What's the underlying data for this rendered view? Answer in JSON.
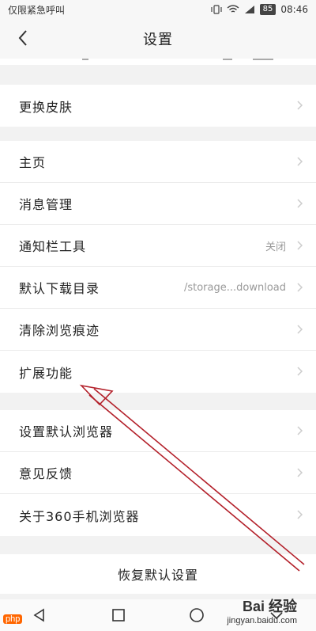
{
  "statusbar": {
    "left_text": "仅限紧急呼叫",
    "battery": "85",
    "time": "08:46"
  },
  "navbar": {
    "title": "设置"
  },
  "groups": {
    "g1": {
      "items": [
        {
          "label": "更换皮肤"
        }
      ]
    },
    "g2": {
      "items": [
        {
          "label": "主页"
        },
        {
          "label": "消息管理"
        },
        {
          "label": "通知栏工具",
          "value": "关闭"
        },
        {
          "label": "默认下载目录",
          "value": "/storage...download"
        },
        {
          "label": "清除浏览痕迹"
        },
        {
          "label": "扩展功能"
        }
      ]
    },
    "g3": {
      "items": [
        {
          "label": "设置默认浏览器"
        },
        {
          "label": "意见反馈"
        },
        {
          "label": "关于360手机浏览器"
        }
      ]
    }
  },
  "restore_label": "恢复默认设置",
  "watermark": {
    "php": "php",
    "baidu": "Bai 经验",
    "url": "jingyan.baidu.com"
  },
  "colors": {
    "annotation_arrow": "#b3202a",
    "background": "#f2f2f2"
  }
}
